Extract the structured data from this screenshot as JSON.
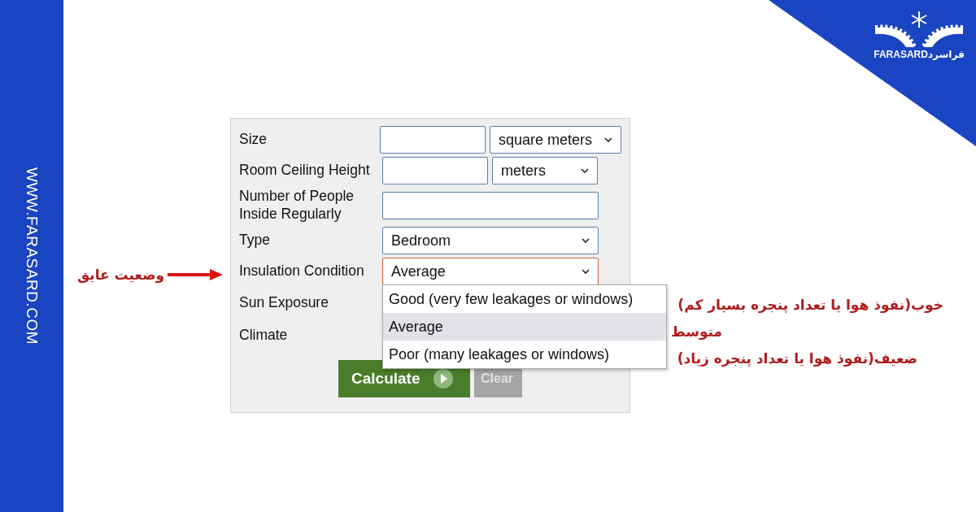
{
  "side_banner": {
    "url": "WWW.FARASARD.COM"
  },
  "logo": {
    "latin": "FARASARD",
    "persian": "فراسرد"
  },
  "form": {
    "rows": [
      {
        "kind": "unit",
        "label": "Size",
        "unit": "square meters"
      },
      {
        "kind": "unit",
        "label": "Room Ceiling Height",
        "unit": "meters"
      },
      {
        "kind": "text",
        "label": "Number of People Inside Regularly"
      },
      {
        "kind": "select",
        "label": "Type",
        "value": "Bedroom",
        "focused": false
      },
      {
        "kind": "select",
        "label": "Insulation Condition",
        "value": "Average",
        "focused": true,
        "options": [
          {
            "label": "Good (very few leakages or windows)",
            "selected": false
          },
          {
            "label": "Average",
            "selected": true
          },
          {
            "label": "Poor (many leakages or windows)",
            "selected": false
          }
        ]
      },
      {
        "kind": "label",
        "label": "Sun Exposure"
      },
      {
        "kind": "label",
        "label": "Climate"
      }
    ],
    "buttons": [
      {
        "kind": "primary",
        "label": "Calculate"
      },
      {
        "kind": "secondary",
        "label": "Clear"
      }
    ]
  },
  "annotations": {
    "left_label": "وضعیت عایق",
    "option_notes": [
      "خوب(نفوذ هوا یا تعداد پنجره بسیار کم)",
      "متوسط",
      "ضعیف(نفوذ هوا یا تعداد پنجره زیاد)"
    ]
  }
}
